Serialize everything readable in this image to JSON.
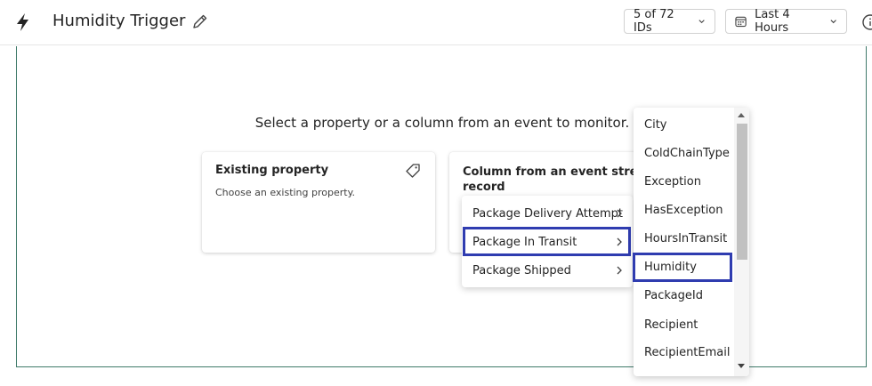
{
  "header": {
    "title": "Humidity Trigger",
    "ids_button": "5 of 72 IDs",
    "time_button": "Last 4 Hours"
  },
  "main": {
    "prompt": "Select a property or a column from an event to monitor."
  },
  "cards": {
    "existing": {
      "title": "Existing property",
      "description": "Choose an existing property."
    },
    "column": {
      "title_line1": "Column from an event stream or",
      "title_line2": "record"
    }
  },
  "event_menu": {
    "items": [
      {
        "label": "Package Delivery Attempt"
      },
      {
        "label": "Package In Transit",
        "selected": true
      },
      {
        "label": "Package Shipped"
      }
    ]
  },
  "column_list": {
    "items": [
      {
        "label": "City"
      },
      {
        "label": "ColdChainType"
      },
      {
        "label": "Exception"
      },
      {
        "label": "HasException"
      },
      {
        "label": "HoursInTransit"
      },
      {
        "label": "Humidity",
        "selected": true
      },
      {
        "label": "PackageId"
      },
      {
        "label": "Recipient"
      },
      {
        "label": "RecipientEmail"
      }
    ]
  },
  "colors": {
    "selection_outline": "#2f3cb0",
    "canvas_border": "#3f7a6a"
  }
}
